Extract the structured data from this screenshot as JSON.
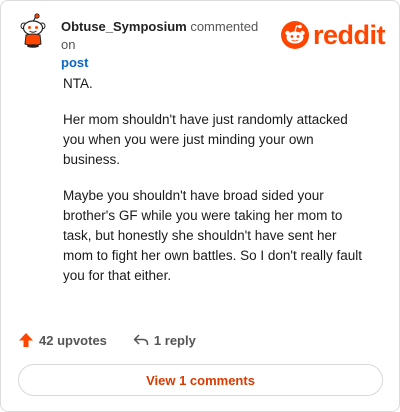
{
  "header": {
    "username": "Obtuse_Symposium",
    "action_text": " commented on ",
    "post_link": "post",
    "brand_text": "reddit",
    "avatar_icon": "snoo-avatar-icon",
    "brand_icon": "reddit-snoo-logo-icon"
  },
  "comment": {
    "paragraphs": [
      "NTA.",
      "Her mom shouldn't have just randomly attacked you when you were just minding your own business.",
      "Maybe you shouldn't have broad sided your brother's GF while you were taking her mom to task, but honestly she shouldn't have sent her mom to fight her own battles. So I don't really fault you for that either."
    ]
  },
  "actions": {
    "upvotes_label": "42 upvotes",
    "reply_label": "1 reply",
    "upvote_icon": "upvote-arrow-icon",
    "reply_icon": "reply-arrow-icon"
  },
  "footer": {
    "view_comments_label": "View 1 comments"
  },
  "colors": {
    "brand": "#ff4500",
    "link": "#0b67c2",
    "button_text": "#d93a00"
  }
}
